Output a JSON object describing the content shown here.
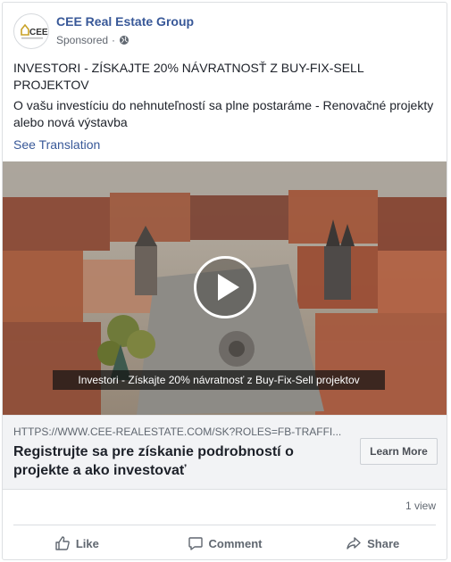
{
  "post": {
    "page_name": "CEE Real Estate Group",
    "sponsored": "Sponsored",
    "separator": "·",
    "avatar_text": "CEE",
    "headline": "INVESTORI - ZÍSKAJTE 20% NÁVRATNOSŤ Z BUY-FIX-SELL PROJEKTOV",
    "body": "O vašu investíciu do nehnuteľností sa plne postaráme - Renovačné projekty alebo nová výstavba",
    "see_translation": "See Translation"
  },
  "video": {
    "caption": "Investori - Získajte 20% návratnosť z Buy-Fix-Sell projektov"
  },
  "link": {
    "url": "HTTPS://WWW.CEE-REALESTATE.COM/SK?ROLES=FB-TRAFFI...",
    "title": "Registrujte sa pre získanie podrobností o projekte a ako investovať",
    "cta": "Learn More"
  },
  "stats": {
    "views": "1 view"
  },
  "actions": {
    "like": "Like",
    "comment": "Comment",
    "share": "Share"
  },
  "colors": {
    "link_blue": "#385898",
    "muted": "#606770",
    "text": "#1d2129",
    "accent_gold": "#c9a227"
  },
  "icons": {
    "globe": "globe-icon",
    "like": "thumbs-up-icon",
    "comment": "comment-bubble-icon",
    "share": "share-arrow-icon",
    "play": "play-icon"
  }
}
